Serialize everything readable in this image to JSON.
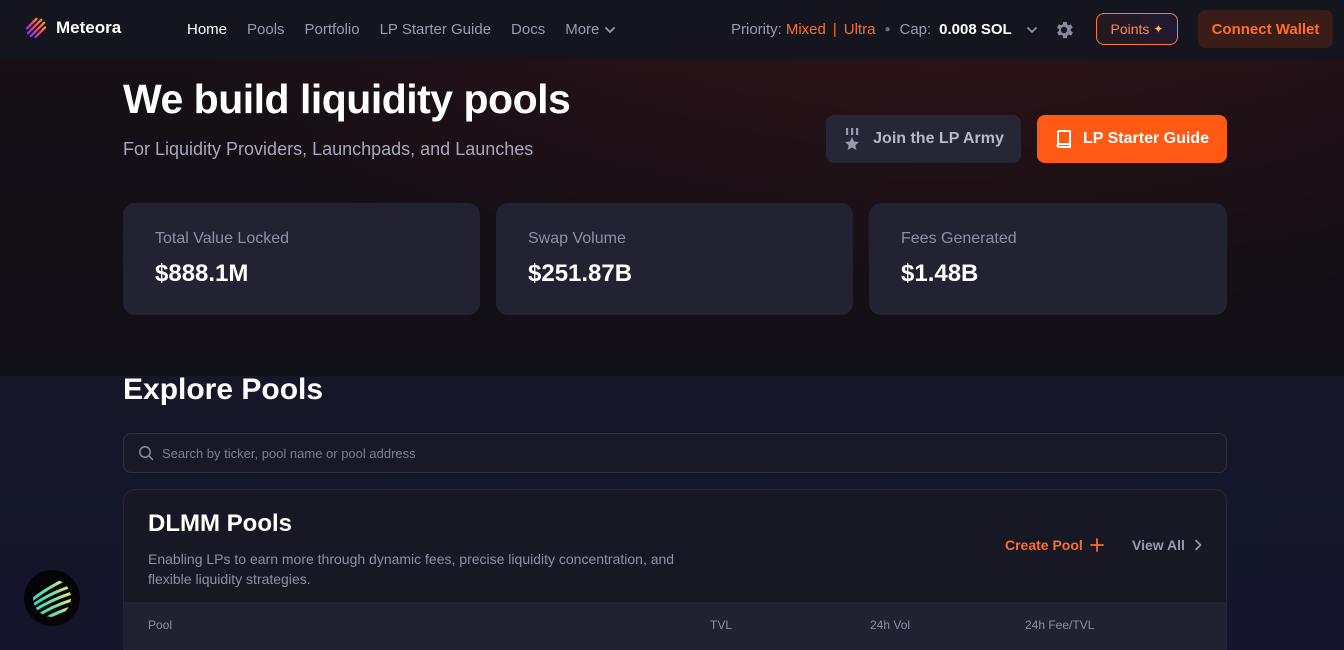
{
  "nav": {
    "brand": "Meteora",
    "links": [
      "Home",
      "Pools",
      "Portfolio",
      "LP Starter Guide",
      "Docs"
    ],
    "more_label": "More",
    "priority_label": "Priority:",
    "priority_mixed": "Mixed",
    "priority_sep": "|",
    "priority_ultra": "Ultra",
    "cap_label": "Cap:",
    "cap_value": "0.008 SOL",
    "points_label": "Points",
    "connect_label": "Connect Wallet"
  },
  "hero": {
    "title": "We build liquidity pools",
    "subtitle": "For Liquidity Providers, Launchpads, and Launches",
    "army_label": "Join the LP Army",
    "guide_label": "LP Starter Guide"
  },
  "stats": [
    {
      "label": "Total Value Locked",
      "value": "$888.1M"
    },
    {
      "label": "Swap Volume",
      "value": "$251.87B"
    },
    {
      "label": "Fees Generated",
      "value": "$1.48B"
    }
  ],
  "explore": {
    "title": "Explore Pools",
    "search_placeholder": "Search by ticker, pool name or pool address"
  },
  "dlmm": {
    "title": "DLMM Pools",
    "description": "Enabling LPs to earn more through dynamic fees, precise liquidity concentration, and flexible liquidity strategies.",
    "create_label": "Create Pool",
    "view_all_label": "View All",
    "columns": [
      "Pool",
      "TVL",
      "24h Vol",
      "24h Fee/TVL"
    ]
  },
  "colors": {
    "accent": "#ff5a14",
    "accent_text": "#ff6d27",
    "card": "#222233",
    "background": "#13131f"
  }
}
